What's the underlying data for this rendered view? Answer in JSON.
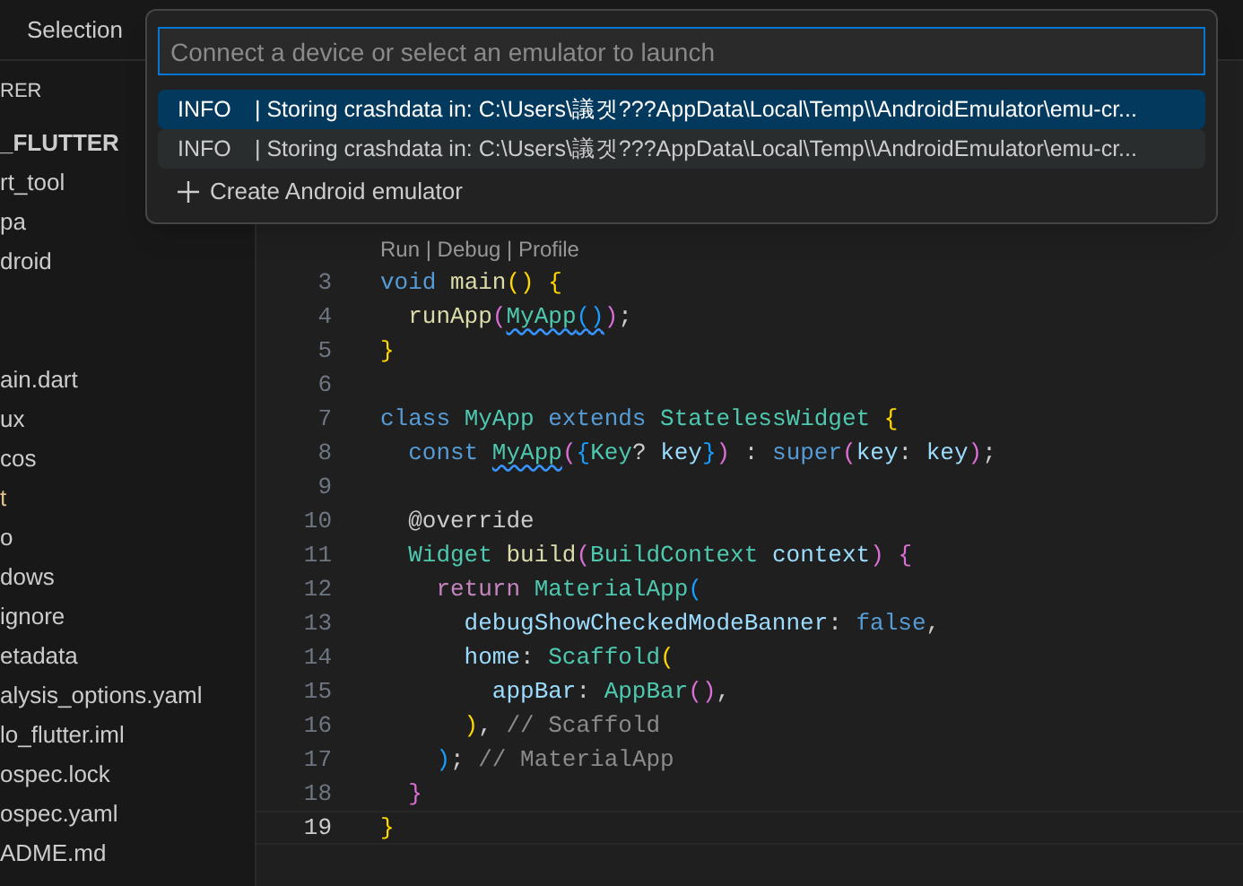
{
  "title_bar": {
    "menu_item": "Selection"
  },
  "sidebar": {
    "header": "RER",
    "groups": [
      [
        {
          "label": "_FLUTTER",
          "kind": "root",
          "color": "#cccccc"
        },
        {
          "label": "rt_tool",
          "kind": "item",
          "color": "#cccccc"
        },
        {
          "label": "pa",
          "kind": "item",
          "color": "#cccccc"
        },
        {
          "label": "droid",
          "kind": "item",
          "color": "#cccccc"
        }
      ],
      [
        {
          "label": "ain.dart",
          "kind": "item",
          "color": "#cccccc"
        },
        {
          "label": "ux",
          "kind": "item",
          "color": "#cccccc"
        },
        {
          "label": "cos",
          "kind": "item",
          "color": "#cccccc"
        },
        {
          "label": "t",
          "kind": "item",
          "color": "#e2c08d"
        },
        {
          "label": "o",
          "kind": "item",
          "color": "#cccccc"
        },
        {
          "label": "dows",
          "kind": "item",
          "color": "#cccccc"
        },
        {
          "label": "ignore",
          "kind": "item",
          "color": "#cccccc"
        },
        {
          "label": "etadata",
          "kind": "item",
          "color": "#cccccc"
        },
        {
          "label": "alysis_options.yaml",
          "kind": "item",
          "color": "#cccccc"
        },
        {
          "label": "lo_flutter.iml",
          "kind": "item",
          "color": "#cccccc"
        },
        {
          "label": "ospec.lock",
          "kind": "item",
          "color": "#cccccc"
        },
        {
          "label": "ospec.yaml",
          "kind": "item",
          "color": "#cccccc"
        },
        {
          "label": "ADME.md",
          "kind": "item",
          "color": "#cccccc"
        }
      ]
    ]
  },
  "editor": {
    "code_lens": "Run | Debug | Profile",
    "lines": [
      {
        "number": "3",
        "current": false,
        "tokens": [
          {
            "text": "void",
            "kind": "keyword"
          },
          {
            "text": " main",
            "kind": "function"
          },
          {
            "text": "()",
            "kind": "bracket1"
          },
          {
            "text": " {",
            "kind": "bracket1"
          }
        ]
      },
      {
        "number": "4",
        "current": false,
        "tokens": [
          {
            "text": "  runApp",
            "kind": "function"
          },
          {
            "text": "(",
            "kind": "bracket2"
          },
          {
            "text": "MyApp",
            "kind": "type",
            "squiggle": true
          },
          {
            "text": "()",
            "kind": "bracket3",
            "squiggle": true
          },
          {
            "text": ")",
            "kind": "bracket2"
          },
          {
            "text": ";"
          }
        ]
      },
      {
        "number": "5",
        "current": false,
        "tokens": [
          {
            "text": "}",
            "kind": "bracket1"
          }
        ]
      },
      {
        "number": "6",
        "current": false
      },
      {
        "number": "7",
        "current": false,
        "tokens": [
          {
            "text": "class",
            "kind": "keyword"
          },
          {
            "text": " MyApp",
            "kind": "type"
          },
          {
            "text": " extends",
            "kind": "keyword"
          },
          {
            "text": " StatelessWidget",
            "kind": "type"
          },
          {
            "text": " {",
            "kind": "bracket1"
          }
        ]
      },
      {
        "number": "8",
        "current": false,
        "tokens": [
          {
            "text": "  const ",
            "kind": "keyword"
          },
          {
            "text": "MyApp",
            "kind": "type",
            "squiggle": true
          },
          {
            "text": "(",
            "kind": "bracket2"
          },
          {
            "text": "{",
            "kind": "bracket3"
          },
          {
            "text": "Key",
            "kind": "type"
          },
          {
            "text": "? "
          },
          {
            "text": "key",
            "kind": "variable"
          },
          {
            "text": "}",
            "kind": "bracket3"
          },
          {
            "text": ")",
            "kind": "bracket2"
          },
          {
            "text": " : "
          },
          {
            "text": "super",
            "kind": "keyword"
          },
          {
            "text": "(",
            "kind": "bracket2"
          },
          {
            "text": "key",
            "kind": "variable"
          },
          {
            "text": ": "
          },
          {
            "text": "key",
            "kind": "variable"
          },
          {
            "text": ")",
            "kind": "bracket2"
          },
          {
            "text": ";"
          }
        ]
      },
      {
        "number": "9",
        "current": false
      },
      {
        "number": "10",
        "current": false,
        "tokens": [
          {
            "text": "  @override"
          }
        ]
      },
      {
        "number": "11",
        "current": false,
        "tokens": [
          {
            "text": "  Widget",
            "kind": "type"
          },
          {
            "text": " build",
            "kind": "function"
          },
          {
            "text": "(",
            "kind": "bracket2"
          },
          {
            "text": "BuildContext",
            "kind": "type"
          },
          {
            "text": " context",
            "kind": "variable"
          },
          {
            "text": ")",
            "kind": "bracket2"
          },
          {
            "text": " {",
            "kind": "bracket2"
          }
        ]
      },
      {
        "number": "12",
        "current": false,
        "tokens": [
          {
            "text": "    return",
            "kind": "control"
          },
          {
            "text": " MaterialApp",
            "kind": "type"
          },
          {
            "text": "(",
            "kind": "bracket3"
          }
        ]
      },
      {
        "number": "13",
        "current": false,
        "tokens": [
          {
            "text": "      debugShowCheckedModeBanner",
            "kind": "variable"
          },
          {
            "text": ": "
          },
          {
            "text": "false",
            "kind": "keyword"
          },
          {
            "text": ","
          }
        ]
      },
      {
        "number": "14",
        "current": false,
        "tokens": [
          {
            "text": "      home",
            "kind": "variable"
          },
          {
            "text": ": "
          },
          {
            "text": "Scaffold",
            "kind": "type"
          },
          {
            "text": "(",
            "kind": "bracket1"
          }
        ]
      },
      {
        "number": "15",
        "current": false,
        "tokens": [
          {
            "text": "        appBar",
            "kind": "variable"
          },
          {
            "text": ": "
          },
          {
            "text": "AppBar",
            "kind": "type"
          },
          {
            "text": "()",
            "kind": "bracket2"
          },
          {
            "text": ","
          }
        ]
      },
      {
        "number": "16",
        "current": false,
        "tokens": [
          {
            "text": "      )",
            "kind": "bracket1"
          },
          {
            "text": ", "
          },
          {
            "text": "// Scaffold",
            "kind": "comment"
          }
        ]
      },
      {
        "number": "17",
        "current": false,
        "tokens": [
          {
            "text": "    )",
            "kind": "bracket3"
          },
          {
            "text": "; "
          },
          {
            "text": "// MaterialApp",
            "kind": "comment"
          }
        ]
      },
      {
        "number": "18",
        "current": false,
        "tokens": [
          {
            "text": "  }",
            "kind": "bracket2"
          }
        ]
      },
      {
        "number": "19",
        "current": true,
        "tokens": [
          {
            "text": "}",
            "kind": "bracket1"
          }
        ]
      }
    ]
  },
  "quick_pick": {
    "placeholder": "Connect a device or select an emulator to launch",
    "options": [
      {
        "level": "INFO",
        "message": "| Storing crashdata in: C:\\Users\\議겟???AppData\\Local\\Temp\\\\AndroidEmulator\\emu-cr...",
        "selected": true
      },
      {
        "level": "INFO",
        "message": "| Storing crashdata in: C:\\Users\\議겟???AppData\\Local\\Temp\\\\AndroidEmulator\\emu-cr...",
        "selected": false
      }
    ],
    "action": "Create Android emulator"
  }
}
